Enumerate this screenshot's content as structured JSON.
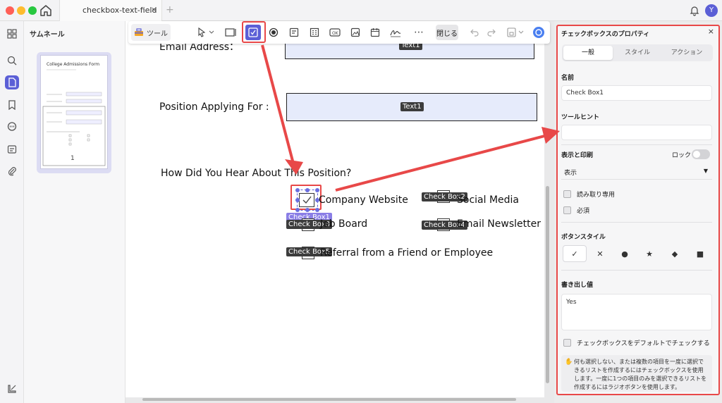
{
  "titlebar": {
    "tab_title": "checkbox-text-field",
    "tab_close": "×",
    "new_tab": "+",
    "avatar_letter": "Y"
  },
  "thumbnails": {
    "title": "サムネール",
    "page_number": "1"
  },
  "toolbar": {
    "tool_label": "ツール",
    "close_label": "閉じる"
  },
  "document": {
    "email_label": "Email Address：",
    "email_field_tag": "Text1",
    "position_label": "Position Applying For :",
    "position_field_tag": "Text1",
    "question": "How Did You Hear About This Position?",
    "options": {
      "company_website": "Company Website",
      "social_media": "Social Media",
      "job_board": "Job Board",
      "email_newsletter": "Email Newsletter",
      "referral": "Referral from a Friend or Employee"
    },
    "tags": {
      "cb1": "Check Box1",
      "cb2": "Check Box2",
      "cb3": "Check Box3",
      "cb4": "Check Box4",
      "cb5": "Check Box5"
    }
  },
  "properties": {
    "title": "チェックボックスのプロパティ",
    "close": "×",
    "tabs": [
      "一般",
      "スタイル",
      "アクション"
    ],
    "name_label": "名前",
    "name_value": "Check Box1",
    "tooltip_label": "ツールヒント",
    "tooltip_value": "",
    "display_label": "表示と印刷",
    "lock_label": "ロック",
    "display_value": "表示",
    "readonly_label": "読み取り専用",
    "required_label": "必須",
    "button_style_label": "ボタンスタイル",
    "button_styles": [
      "✓",
      "✕",
      "●",
      "★",
      "◆",
      "■"
    ],
    "export_label": "書き出し値",
    "export_value": "Yes",
    "default_check_label": "チェックボックスをデフォルトでチェックする",
    "hint_text": "何も選択しない、または複数の項目を一度に選択できるリストを作成するにはチェックボックスを使用します。一度に1つの項目のみを選択できるリストを作成するにはラジオボタンを使用します。"
  },
  "colors": {
    "accent": "#5b5fd6",
    "highlight": "#e84848",
    "field_fill": "#e6ebfb"
  }
}
